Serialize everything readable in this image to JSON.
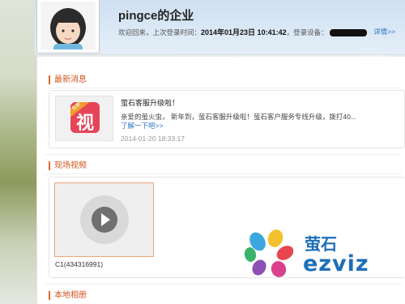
{
  "header": {
    "username": "pingce的企业",
    "welcome": "欢迎回来，上次登录时间：",
    "last_login": "2014年01月23日 10:41:42",
    "device_label": "，登录设备：",
    "details_link": "详情>>"
  },
  "news": {
    "section_title": "最新消息",
    "badge": "免费",
    "icon_glyph": "视",
    "title": "萤石客服升级啦！",
    "body": "亲爱的萤火虫， 新年到，萤石客服升级啦！萤石客户服务专线升级，拨打40...",
    "more_link": "了解一下吧>>",
    "date": "2014-01-20 18:33:17"
  },
  "live_video": {
    "section_title": "现场视频",
    "camera_label": "C1(434316991)"
  },
  "album": {
    "section_title": "本地相册"
  },
  "watermark": {
    "cn": "萤石",
    "en": "ezviz"
  },
  "colors": {
    "accent": "#e06a2c",
    "link": "#2a73c6",
    "brand": "#1e6fb8"
  }
}
